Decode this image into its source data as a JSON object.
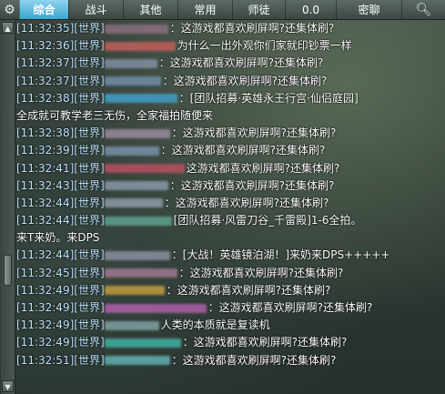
{
  "tabs": [
    {
      "label": "综合",
      "active": true
    },
    {
      "label": "战斗",
      "active": false
    },
    {
      "label": "其他",
      "active": false
    },
    {
      "label": "常用",
      "active": false
    },
    {
      "label": "师徒",
      "active": false
    },
    {
      "label": "0.0",
      "active": false
    },
    {
      "label": "密聊",
      "active": false
    }
  ],
  "icons": {
    "settings": "gear-icon",
    "search": "search-icon",
    "scroll_up": "scroll-up-arrow-icon",
    "scroll_down": "scroll-down-arrow-icon"
  },
  "colors": {
    "active_tab": "#3aa6d0",
    "timestamp": "#bfe6ff",
    "message": "#ffffff"
  },
  "chat": {
    "lines": [
      {
        "time": "[11:32:35]",
        "channel": "[世界]",
        "blur": "#8a6f7f",
        "msg": "：这游戏都喜欢刷屏啊?还集体刷?"
      },
      {
        "time": "[11:32:36]",
        "channel": "[世界]",
        "blur": "#c0605a",
        "msg": "为什么一出外观你们家就印钞票一样"
      },
      {
        "time": "[11:32:37]",
        "channel": "[世界]",
        "blur": "#7f8fa0",
        "msg": "：这游戏都喜欢刷屏啊?还集体刷?"
      },
      {
        "time": "[11:32:37]",
        "channel": "[世界]",
        "blur": "#6f8ea8",
        "msg": "：这游戏都喜欢刷屏啊?还集体刷?"
      },
      {
        "time": "[11:32:38]",
        "channel": "[世界]",
        "blur": "#3fa0c8",
        "msg": "：[团队招募·英雄永王行宫·仙侣庭园]"
      },
      {
        "time": "",
        "channel": "",
        "blur": "",
        "msg": "全成就可教学老三无伤，全家福拍随便来"
      },
      {
        "time": "[11:32:38]",
        "channel": "[世界]",
        "blur": "#9a8aa0",
        "msg": "：这游戏都喜欢刷屏啊?还集体刷?"
      },
      {
        "time": "[11:32:39]",
        "channel": "[世界]",
        "blur": "#7a90a8",
        "msg": "：这游戏都喜欢刷屏啊?还集体刷?"
      },
      {
        "time": "[11:32:41]",
        "channel": "[世界]",
        "blur": "#b85060",
        "msg": "这游戏都喜欢刷屏啊?还集体刷?"
      },
      {
        "time": "[11:32:43]",
        "channel": "[世界]",
        "blur": "#8898a8",
        "msg": "：这游戏都喜欢刷屏啊?还集体刷?"
      },
      {
        "time": "[11:32:44]",
        "channel": "[世界]",
        "blur": "#909aa8",
        "msg": "：这游戏都喜欢刷屏啊?还集体刷?"
      },
      {
        "time": "[11:32:44]",
        "channel": "[世界]",
        "blur": "#5fa090",
        "msg": "[团队招募·风雷刀谷_千雷殿]1-6全拍。"
      },
      {
        "time": "",
        "channel": "",
        "blur": "",
        "msg": "来T来奶。来DPS"
      },
      {
        "time": "[11:32:44]",
        "channel": "[世界]",
        "blur": "#8a8fa0",
        "msg": "：[大战！英雄镜泊湖！]来奶来DPS+++++"
      },
      {
        "time": "[11:32:45]",
        "channel": "[世界]",
        "blur": "#a07890",
        "msg": "：这游戏都喜欢刷屏啊?还集体刷?"
      },
      {
        "time": "[11:32:49]",
        "channel": "[世界]",
        "blur": "#c09a40",
        "msg": "：这游戏都喜欢刷屏啊?还集体刷?"
      },
      {
        "time": "[11:32:49]",
        "channel": "[世界]",
        "blur": "#b060a8",
        "msg": "：这游戏都喜欢刷屏啊?还集体刷?"
      },
      {
        "time": "[11:32:49]",
        "channel": "[世界]",
        "blur": "#7fa0a0",
        "msg": "人类的本质就是复读机"
      },
      {
        "time": "[11:32:49]",
        "channel": "[世界]",
        "blur": "#40b0a0",
        "msg": "：这游戏都喜欢刷屏啊?还集体刷?"
      },
      {
        "time": "[11:32:51]",
        "channel": "[世界]",
        "blur": "#60b0b0",
        "msg": "：这游戏都喜欢刷屏啊?还集体刷?"
      }
    ]
  }
}
